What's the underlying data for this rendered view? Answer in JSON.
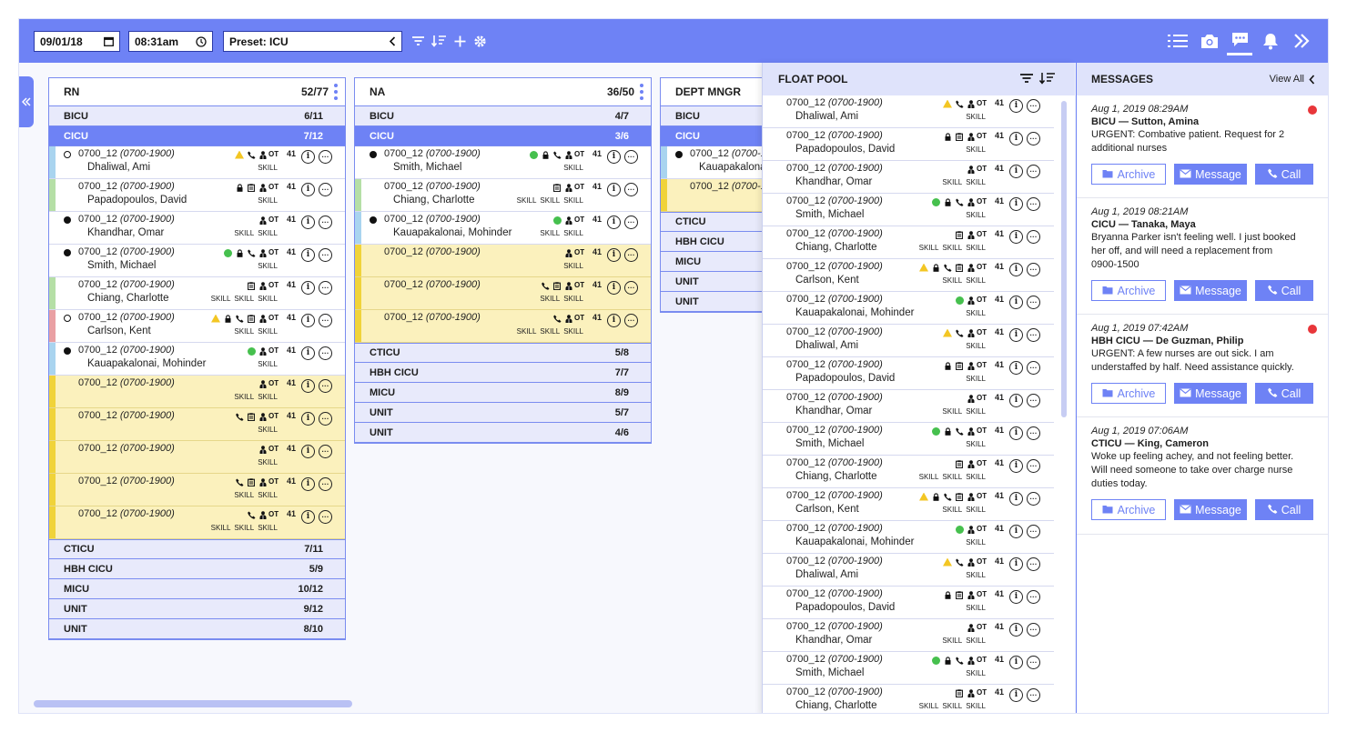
{
  "toolbar": {
    "date": "09/01/18",
    "time": "08:31am",
    "preset": "Preset: ICU"
  },
  "colors": {
    "accent": "#6e82f5",
    "warn": "#f3c623",
    "ok": "#46c04e",
    "alert": "#e8363a"
  },
  "columns": [
    {
      "title": "RN",
      "count": "52/77",
      "top_units": [
        {
          "name": "BICU",
          "count": "6/11",
          "active": false
        },
        {
          "name": "CICU",
          "count": "7/12",
          "active": true
        }
      ],
      "rows": [
        {
          "shift": "0700_12",
          "hours": "(0700-1900)",
          "name": "Dhaliwal, Ami",
          "dot": "empty",
          "bar": "#a9d4ef",
          "warn": true,
          "ok": false,
          "icons": [
            "phone"
          ],
          "skills": [
            "SKILL"
          ]
        },
        {
          "shift": "0700_12",
          "hours": "(0700-1900)",
          "name": "Papadopoulos, David",
          "dot": "",
          "bar": "#b5dfa6",
          "warn": false,
          "ok": false,
          "icons": [
            "lock",
            "clipboard"
          ],
          "skills": [
            "SKILL"
          ]
        },
        {
          "shift": "0700_12",
          "hours": "(0700-1900)",
          "name": "Khandhar, Omar",
          "dot": "filled",
          "bar": "",
          "warn": false,
          "ok": false,
          "icons": [],
          "skills": [
            "SKILL",
            "SKILL"
          ]
        },
        {
          "shift": "0700_12",
          "hours": "(0700-1900)",
          "name": "Smith, Michael",
          "dot": "filled",
          "bar": "",
          "warn": false,
          "ok": true,
          "icons": [
            "lock",
            "phone"
          ],
          "skills": [
            "SKILL"
          ]
        },
        {
          "shift": "0700_12",
          "hours": "(0700-1900)",
          "name": "Chiang, Charlotte",
          "dot": "",
          "bar": "#b5dfa6",
          "warn": false,
          "ok": false,
          "icons": [
            "clipboard"
          ],
          "skills": [
            "SKILL",
            "SKILL",
            "SKILL"
          ]
        },
        {
          "shift": "0700_12",
          "hours": "(0700-1900)",
          "name": "Carlson, Kent",
          "dot": "empty",
          "bar": "#e9a0a3",
          "warn": true,
          "ok": false,
          "icons": [
            "lock",
            "phone",
            "clipboard"
          ],
          "skills": [
            "SKILL",
            "SKILL"
          ]
        },
        {
          "shift": "0700_12",
          "hours": "(0700-1900)",
          "name": "Kauapakalonai, Mohinder",
          "dot": "filled",
          "bar": "#a9d4ef",
          "warn": false,
          "ok": true,
          "icons": [],
          "skills": [
            "SKILL"
          ]
        },
        {
          "shift": "0700_12",
          "hours": "(0700-1900)",
          "name": "",
          "dot": "",
          "bar": "#f0d33a",
          "open": true,
          "warn": false,
          "ok": false,
          "icons": [],
          "skills": [
            "SKILL",
            "SKILL"
          ]
        },
        {
          "shift": "0700_12",
          "hours": "(0700-1900)",
          "name": "",
          "dot": "",
          "bar": "#f0d33a",
          "open": true,
          "warn": false,
          "ok": false,
          "icons": [
            "phone",
            "clipboard"
          ],
          "skills": [
            "SKILL"
          ]
        },
        {
          "shift": "0700_12",
          "hours": "(0700-1900)",
          "name": "",
          "dot": "",
          "bar": "#f0d33a",
          "open": true,
          "warn": false,
          "ok": false,
          "icons": [],
          "skills": [
            "SKILL"
          ]
        },
        {
          "shift": "0700_12",
          "hours": "(0700-1900)",
          "name": "",
          "dot": "",
          "bar": "#f0d33a",
          "open": true,
          "warn": false,
          "ok": false,
          "icons": [
            "phone",
            "clipboard"
          ],
          "skills": [
            "SKILL",
            "SKILL"
          ]
        },
        {
          "shift": "0700_12",
          "hours": "(0700-1900)",
          "name": "",
          "dot": "",
          "bar": "#f0d33a",
          "open": true,
          "warn": false,
          "ok": false,
          "icons": [
            "phone"
          ],
          "skills": [
            "SKILL",
            "SKILL",
            "SKILL"
          ]
        }
      ],
      "bottom_units": [
        {
          "name": "CTICU",
          "count": "7/11"
        },
        {
          "name": "HBH CICU",
          "count": "5/9"
        },
        {
          "name": "MICU",
          "count": "10/12"
        },
        {
          "name": "UNIT",
          "count": "9/12"
        },
        {
          "name": "UNIT",
          "count": "8/10"
        }
      ]
    },
    {
      "title": "NA",
      "count": "36/50",
      "top_units": [
        {
          "name": "BICU",
          "count": "4/7",
          "active": false
        },
        {
          "name": "CICU",
          "count": "3/6",
          "active": true
        }
      ],
      "rows": [
        {
          "shift": "0700_12",
          "hours": "(0700-1900)",
          "name": "Smith, Michael",
          "dot": "filled",
          "bar": "",
          "warn": false,
          "ok": true,
          "icons": [
            "lock",
            "phone"
          ],
          "skills": [
            "SKILL"
          ]
        },
        {
          "shift": "0700_12",
          "hours": "(0700-1900)",
          "name": "Chiang, Charlotte",
          "dot": "",
          "bar": "#b5dfa6",
          "warn": false,
          "ok": false,
          "icons": [
            "clipboard"
          ],
          "skills": [
            "SKILL",
            "SKILL",
            "SKILL"
          ]
        },
        {
          "shift": "0700_12",
          "hours": "(0700-1900)",
          "name": "Kauapakalonai, Mohinder",
          "dot": "filled",
          "bar": "#a9d4ef",
          "warn": false,
          "ok": true,
          "icons": [],
          "skills": [
            "SKILL",
            "SKILL"
          ]
        },
        {
          "shift": "0700_12",
          "hours": "(0700-1900)",
          "name": "",
          "dot": "",
          "bar": "#f0d33a",
          "open": true,
          "warn": false,
          "ok": false,
          "icons": [],
          "skills": [
            "SKILL"
          ]
        },
        {
          "shift": "0700_12",
          "hours": "(0700-1900)",
          "name": "",
          "dot": "",
          "bar": "#f0d33a",
          "open": true,
          "warn": false,
          "ok": false,
          "icons": [
            "phone",
            "clipboard"
          ],
          "skills": [
            "SKILL",
            "SKILL"
          ]
        },
        {
          "shift": "0700_12",
          "hours": "(0700-1900)",
          "name": "",
          "dot": "",
          "bar": "#f0d33a",
          "open": true,
          "warn": false,
          "ok": false,
          "icons": [
            "phone"
          ],
          "skills": [
            "SKILL",
            "SKILL",
            "SKILL"
          ]
        }
      ],
      "bottom_units": [
        {
          "name": "CTICU",
          "count": "5/8"
        },
        {
          "name": "HBH CICU",
          "count": "7/7"
        },
        {
          "name": "MICU",
          "count": "8/9"
        },
        {
          "name": "UNIT",
          "count": "5/7"
        },
        {
          "name": "UNIT",
          "count": "4/6"
        }
      ]
    },
    {
      "title": "DEPT MNGR",
      "count": "",
      "top_units": [
        {
          "name": "BICU",
          "count": "",
          "active": false
        },
        {
          "name": "CICU",
          "count": "",
          "active": true
        }
      ],
      "rows": [
        {
          "shift": "0700_12",
          "hours": "(0700-19",
          "name": "Kauapakalonai",
          "dot": "filled",
          "bar": "#a9d4ef",
          "warn": false,
          "ok": false,
          "icons": [],
          "skills": []
        },
        {
          "shift": "0700_12",
          "hours": "(0700-19",
          "name": "",
          "dot": "",
          "bar": "#f0d33a",
          "open": true,
          "warn": false,
          "ok": false,
          "icons": [],
          "skills": []
        }
      ],
      "bottom_units": [
        {
          "name": "CTICU",
          "count": ""
        },
        {
          "name": "HBH CICU",
          "count": ""
        },
        {
          "name": "MICU",
          "count": ""
        },
        {
          "name": "UNIT",
          "count": ""
        },
        {
          "name": "UNIT",
          "count": ""
        }
      ]
    }
  ],
  "float_pool": {
    "title": "FLOAT POOL",
    "rows": [
      {
        "shift": "0700_12",
        "hours": "(0700-1900)",
        "name": "Dhaliwal, Ami",
        "warn": true,
        "ok": false,
        "icons": [
          "phone"
        ],
        "skills": [
          "SKILL"
        ]
      },
      {
        "shift": "0700_12",
        "hours": "(0700-1900)",
        "name": "Papadopoulos, David",
        "warn": false,
        "ok": false,
        "icons": [
          "lock",
          "clipboard"
        ],
        "skills": [
          "SKILL"
        ]
      },
      {
        "shift": "0700_12",
        "hours": "(0700-1900)",
        "name": "Khandhar, Omar",
        "warn": false,
        "ok": false,
        "icons": [],
        "skills": [
          "SKILL",
          "SKILL"
        ]
      },
      {
        "shift": "0700_12",
        "hours": "(0700-1900)",
        "name": "Smith, Michael",
        "warn": false,
        "ok": true,
        "icons": [
          "lock",
          "phone"
        ],
        "skills": [
          "SKILL"
        ]
      },
      {
        "shift": "0700_12",
        "hours": "(0700-1900)",
        "name": "Chiang, Charlotte",
        "warn": false,
        "ok": false,
        "icons": [
          "clipboard"
        ],
        "skills": [
          "SKILL",
          "SKILL",
          "SKILL"
        ]
      },
      {
        "shift": "0700_12",
        "hours": "(0700-1900)",
        "name": "Carlson, Kent",
        "warn": true,
        "ok": false,
        "icons": [
          "lock",
          "phone",
          "clipboard"
        ],
        "skills": [
          "SKILL",
          "SKILL"
        ]
      },
      {
        "shift": "0700_12",
        "hours": "(0700-1900)",
        "name": "Kauapakalonai, Mohinder",
        "warn": false,
        "ok": true,
        "icons": [],
        "skills": [
          "SKILL"
        ]
      },
      {
        "shift": "0700_12",
        "hours": "(0700-1900)",
        "name": "Dhaliwal, Ami",
        "warn": true,
        "ok": false,
        "icons": [
          "phone"
        ],
        "skills": [
          "SKILL"
        ]
      },
      {
        "shift": "0700_12",
        "hours": "(0700-1900)",
        "name": "Papadopoulos, David",
        "warn": false,
        "ok": false,
        "icons": [
          "lock",
          "clipboard"
        ],
        "skills": [
          "SKILL"
        ]
      },
      {
        "shift": "0700_12",
        "hours": "(0700-1900)",
        "name": "Khandhar, Omar",
        "warn": false,
        "ok": false,
        "icons": [],
        "skills": [
          "SKILL",
          "SKILL"
        ]
      },
      {
        "shift": "0700_12",
        "hours": "(0700-1900)",
        "name": "Smith, Michael",
        "warn": false,
        "ok": true,
        "icons": [
          "lock",
          "phone"
        ],
        "skills": [
          "SKILL"
        ]
      },
      {
        "shift": "0700_12",
        "hours": "(0700-1900)",
        "name": "Chiang, Charlotte",
        "warn": false,
        "ok": false,
        "icons": [
          "clipboard"
        ],
        "skills": [
          "SKILL",
          "SKILL",
          "SKILL"
        ]
      },
      {
        "shift": "0700_12",
        "hours": "(0700-1900)",
        "name": "Carlson, Kent",
        "warn": true,
        "ok": false,
        "icons": [
          "lock",
          "phone",
          "clipboard"
        ],
        "skills": [
          "SKILL",
          "SKILL"
        ]
      },
      {
        "shift": "0700_12",
        "hours": "(0700-1900)",
        "name": "Kauapakalonai, Mohinder",
        "warn": false,
        "ok": true,
        "icons": [],
        "skills": [
          "SKILL"
        ]
      },
      {
        "shift": "0700_12",
        "hours": "(0700-1900)",
        "name": "Dhaliwal, Ami",
        "warn": true,
        "ok": false,
        "icons": [
          "phone"
        ],
        "skills": [
          "SKILL"
        ]
      },
      {
        "shift": "0700_12",
        "hours": "(0700-1900)",
        "name": "Papadopoulos, David",
        "warn": false,
        "ok": false,
        "icons": [
          "lock",
          "clipboard"
        ],
        "skills": [
          "SKILL"
        ]
      },
      {
        "shift": "0700_12",
        "hours": "(0700-1900)",
        "name": "Khandhar, Omar",
        "warn": false,
        "ok": false,
        "icons": [],
        "skills": [
          "SKILL",
          "SKILL"
        ]
      },
      {
        "shift": "0700_12",
        "hours": "(0700-1900)",
        "name": "Smith, Michael",
        "warn": false,
        "ok": true,
        "icons": [
          "lock",
          "phone"
        ],
        "skills": [
          "SKILL"
        ]
      },
      {
        "shift": "0700_12",
        "hours": "(0700-1900)",
        "name": "Chiang, Charlotte",
        "warn": false,
        "ok": false,
        "icons": [
          "clipboard"
        ],
        "skills": [
          "SKILL",
          "SKILL",
          "SKILL"
        ]
      }
    ]
  },
  "row_common": {
    "ot": "OT",
    "num": "41",
    "info": "i",
    "more": "···"
  },
  "messages": {
    "title": "MESSAGES",
    "view_all": "View All",
    "items": [
      {
        "time": "Aug 1, 2019 08:29AM",
        "title": "BICU — Sutton, Amina",
        "body": "URGENT: Combative patient. Request for 2 additional nurses",
        "unread": true
      },
      {
        "time": "Aug 1, 2019 08:21AM",
        "title": "CICU — Tanaka, Maya",
        "body": "Bryanna Parker isn't feeling well. I just booked her off, and will need a replacement from 0900-1500",
        "unread": false
      },
      {
        "time": "Aug 1, 2019 07:42AM",
        "title": "HBH CICU — De Guzman, Philip",
        "body": "URGENT: A few nurses are out sick. I am understaffed by half. Need assistance quickly.",
        "unread": true
      },
      {
        "time": "Aug 1, 2019 07:06AM",
        "title": "CTICU — King, Cameron",
        "body": "Woke up feeling achey, and not feeling better. Will need someone to take over charge nurse duties today.",
        "unread": false
      }
    ],
    "archive_label": "Archive",
    "message_label": "Message",
    "call_label": "Call"
  }
}
